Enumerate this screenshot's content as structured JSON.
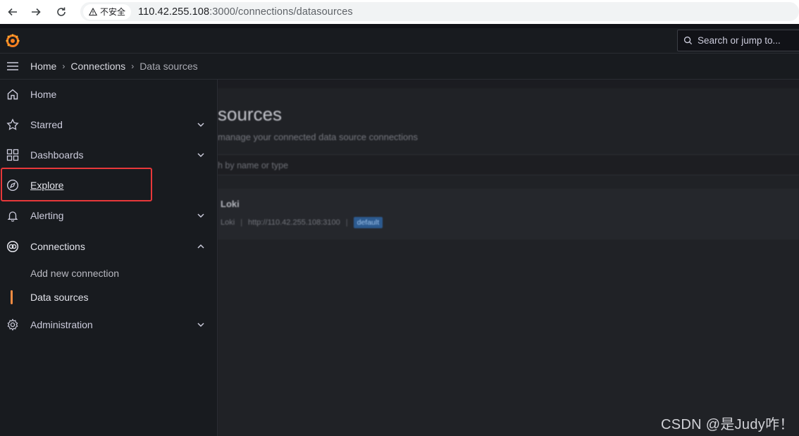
{
  "browser": {
    "security_label": "不安全",
    "url_host": "110.42.255.108",
    "url_rest": ":3000/connections/datasources"
  },
  "topbar": {
    "search_placeholder": "Search or jump to..."
  },
  "breadcrumbs": [
    "Home",
    "Connections",
    "Data sources"
  ],
  "sidebar": {
    "items": [
      {
        "label": "Home",
        "icon": "home-icon"
      },
      {
        "label": "Starred",
        "icon": "star-icon"
      },
      {
        "label": "Dashboards",
        "icon": "dashboards-icon"
      },
      {
        "label": "Explore",
        "icon": "compass-icon"
      },
      {
        "label": "Alerting",
        "icon": "bell-icon"
      },
      {
        "label": "Connections",
        "icon": "connections-icon"
      },
      {
        "label": "Administration",
        "icon": "gear-icon"
      }
    ],
    "sub_items": [
      "Add new connection",
      "Data sources"
    ]
  },
  "main": {
    "title": "sources",
    "subtitle": "manage your connected data source connections",
    "filter_placeholder": "h by name or type",
    "datasource": {
      "name": "Loki",
      "type": "Loki",
      "url": "http://110.42.255.108:3100",
      "badge": "default"
    }
  },
  "watermark": "CSDN @是Judy咋！",
  "colors": {
    "accent": "#f58c42",
    "highlight": "#e8383a",
    "badge": "#2c5a8f"
  }
}
